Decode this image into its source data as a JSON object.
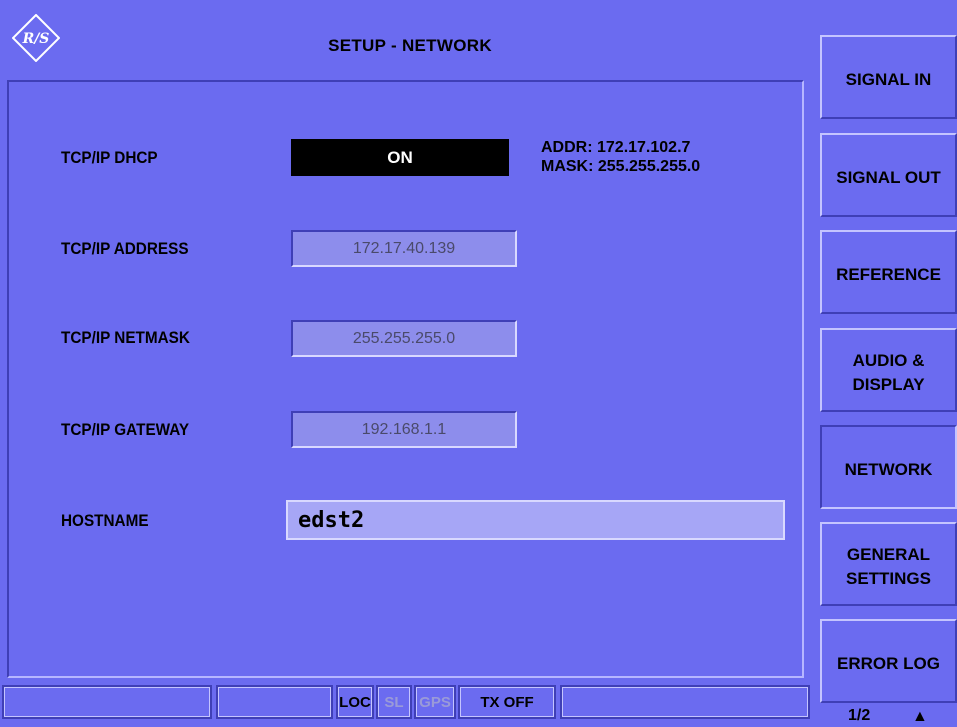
{
  "title": "SETUP - NETWORK",
  "logo_text": "R&S",
  "rows": {
    "dhcp_label": "TCP/IP DHCP",
    "dhcp_value": "ON",
    "address_label": "TCP/IP ADDRESS",
    "address_value": "172.17.40.139",
    "netmask_label": "TCP/IP NETMASK",
    "netmask_value": "255.255.255.0",
    "gateway_label": "TCP/IP GATEWAY",
    "gateway_value": "192.168.1.1",
    "hostname_label": "HOSTNAME",
    "hostname_value": "edst2"
  },
  "info": {
    "addr": "ADDR: 172.17.102.7",
    "mask": "MASK: 255.255.255.0"
  },
  "softkeys": {
    "signal_in": "SIGNAL IN",
    "signal_out": "SIGNAL OUT",
    "reference": "REFERENCE",
    "audio_1": "AUDIO &",
    "audio_2": "DISPLAY",
    "network": "NETWORK",
    "general_1": "GENERAL",
    "general_2": "SETTINGS",
    "error_log": "ERROR LOG"
  },
  "status": {
    "loc": "LOC",
    "sl": "SL",
    "gps": "GPS",
    "txoff": "TX OFF"
  },
  "page_indicator": "1/2",
  "page_arrow": "▲",
  "colors": {
    "background": "#6b6bf0",
    "field": "#8d8dec",
    "hostname_field": "#a6a6f6"
  }
}
